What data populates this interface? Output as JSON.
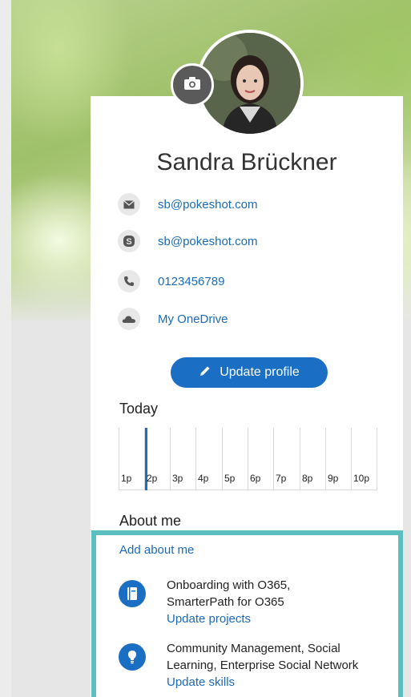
{
  "profile": {
    "name": "Sandra Brückner",
    "photo_alt": "profile photo"
  },
  "contacts": [
    {
      "icon": "mail-icon",
      "value": "sb@pokeshot.com"
    },
    {
      "icon": "skype-icon",
      "value": "sb@pokeshot.com"
    },
    {
      "icon": "phone-icon",
      "value": "0123456789"
    },
    {
      "icon": "onedrive-icon",
      "value": "My OneDrive"
    }
  ],
  "actions": {
    "update_profile": "Update profile"
  },
  "today": {
    "title": "Today",
    "hours": [
      "1p",
      "2p",
      "3p",
      "4p",
      "5p",
      "6p",
      "7p",
      "8p",
      "9p",
      "10p"
    ],
    "current_hour": "2p"
  },
  "about": {
    "title": "About me",
    "add_link": "Add about me",
    "projects_line1": "Onboarding with O365,",
    "projects_line2": "SmarterPath for O365",
    "projects_link": "Update projects",
    "skills_line1": "Community Management, Social",
    "skills_line2": "Learning, Enterprise Social Network",
    "skills_link": "Update skills"
  },
  "colors": {
    "accent": "#1a6fc4",
    "highlight_border": "#5bbfbf"
  }
}
